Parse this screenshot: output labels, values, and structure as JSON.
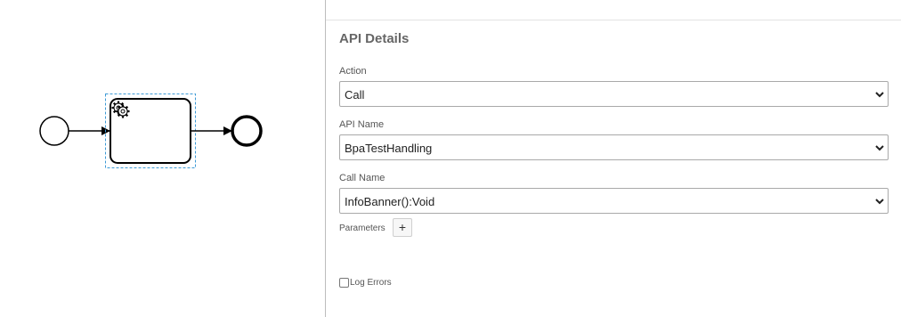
{
  "diagram": {
    "start_event": "start-event",
    "service_task_icon": "gear-icon",
    "end_event": "end-event",
    "selection_color": "#3d9ad6"
  },
  "panel": {
    "title": "API Details",
    "action": {
      "label": "Action",
      "value": "Call"
    },
    "api_name": {
      "label": "API Name",
      "value": "BpaTestHandling"
    },
    "call_name": {
      "label": "Call Name",
      "value": "InfoBanner():Void"
    },
    "parameters": {
      "label": "Parameters",
      "add_label": "+"
    },
    "log_errors": {
      "label": "Log Errors",
      "checked": false
    }
  }
}
